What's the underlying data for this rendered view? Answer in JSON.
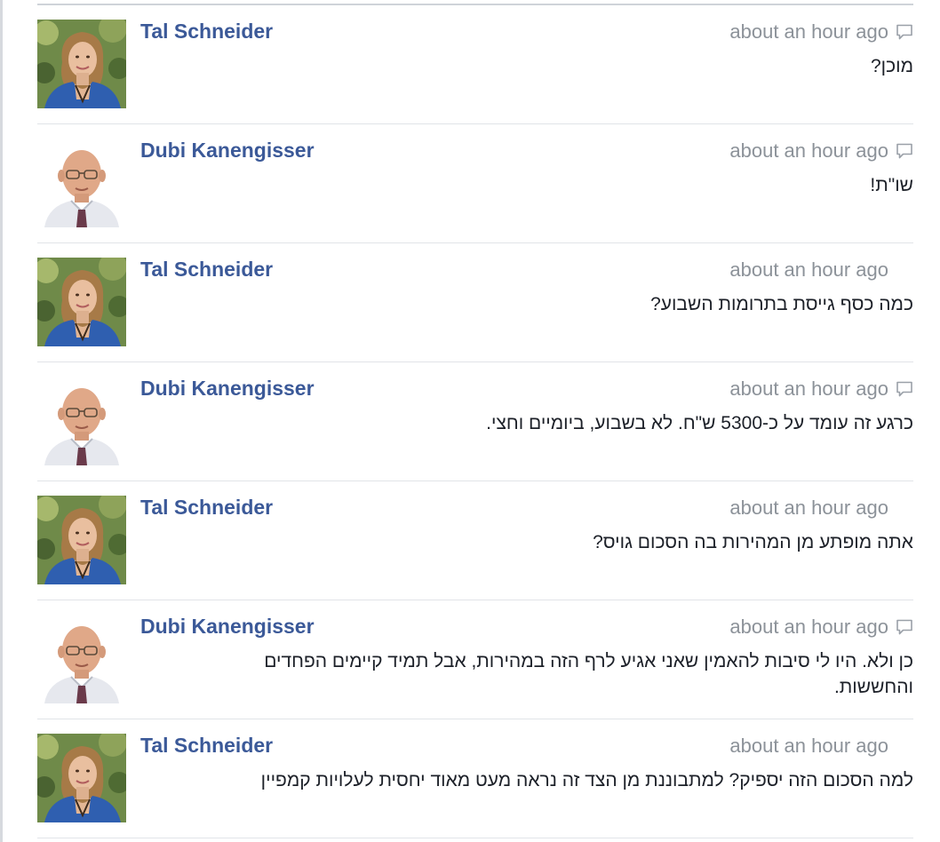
{
  "comments": [
    {
      "author": "Tal Schneider",
      "avatar": "tal",
      "time": "about an hour ago",
      "reply_icon": true,
      "text": "מוכן?"
    },
    {
      "author": "Dubi Kanengisser",
      "avatar": "dubi",
      "time": "about an hour ago",
      "reply_icon": true,
      "text": "שו\"ת!"
    },
    {
      "author": "Tal Schneider",
      "avatar": "tal",
      "time": "about an hour ago",
      "reply_icon": false,
      "text": "כמה כסף גייסת בתרומות השבוע?"
    },
    {
      "author": "Dubi Kanengisser",
      "avatar": "dubi",
      "time": "about an hour ago",
      "reply_icon": true,
      "text": "כרגע זה עומד על כ-5300 ש\"ח. לא בשבוע, ביומיים וחצי."
    },
    {
      "author": "Tal Schneider",
      "avatar": "tal",
      "time": "about an hour ago",
      "reply_icon": false,
      "text": "אתה מופתע מן המהירות בה הסכום גויס?"
    },
    {
      "author": "Dubi Kanengisser",
      "avatar": "dubi",
      "time": "about an hour ago",
      "reply_icon": true,
      "text": "כן ולא. היו לי סיבות להאמין שאני אגיע לרף הזה במהירות, אבל תמיד קיימים הפחדים והחששות."
    },
    {
      "author": "Tal Schneider",
      "avatar": "tal",
      "time": "about an hour ago",
      "reply_icon": false,
      "text": "למה הסכום הזה יספיק? למתבוננת מן הצד זה נראה מעט מאוד יחסית לעלויות קמפיין"
    }
  ],
  "icons": {
    "reply": "speech-bubble-icon"
  },
  "colors": {
    "author_link": "#3b5998",
    "timestamp": "#8c9299",
    "body_text": "#1d2129",
    "divider": "#e1e4e8"
  }
}
